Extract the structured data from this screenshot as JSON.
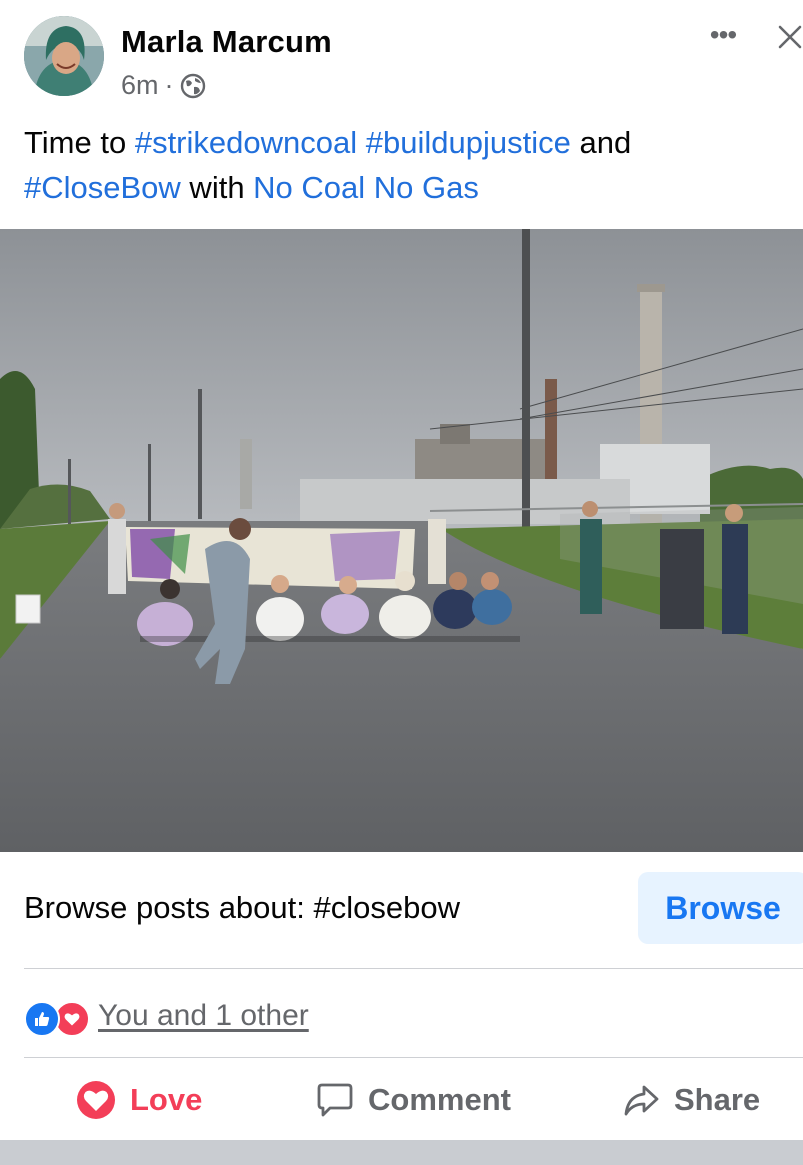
{
  "post": {
    "author": "Marla Marcum",
    "time": "6m",
    "separator": "·",
    "privacy_icon": "globe-icon",
    "menu_icon": "more-horizontal-icon",
    "close_icon": "close-icon"
  },
  "caption": {
    "parts": [
      {
        "text": "Time to ",
        "type": "text"
      },
      {
        "text": "#strikedowncoal",
        "type": "tag"
      },
      {
        "text": " ",
        "type": "text"
      },
      {
        "text": "#buildupjustice",
        "type": "tag"
      },
      {
        "text": " and ",
        "type": "text"
      },
      {
        "text": "#CloseBow",
        "type": "tag"
      },
      {
        "text": " with ",
        "type": "text"
      },
      {
        "text": "No Coal No Gas",
        "type": "tag"
      }
    ]
  },
  "browse": {
    "text": "Browse posts about: #closebow",
    "button_label": "Browse"
  },
  "reactions": {
    "summary": "You and 1 other",
    "icons": [
      "like-icon",
      "love-icon"
    ]
  },
  "actions": {
    "love_label": "Love",
    "comment_label": "Comment",
    "share_label": "Share"
  },
  "colors": {
    "link": "#216fdb",
    "love": "#f33e58",
    "like": "#1877f2",
    "muted": "#65676b",
    "browse_bg": "#e7f3ff"
  }
}
